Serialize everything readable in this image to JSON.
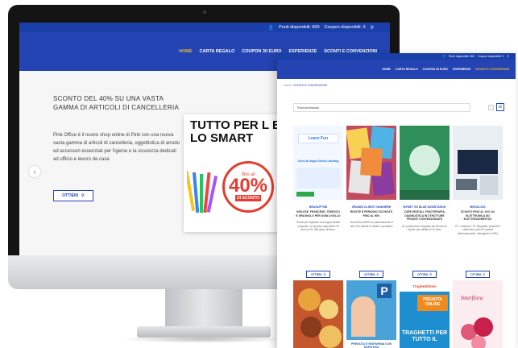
{
  "topbar": {
    "points": "Punti disponibili: 600",
    "coupons": "Coupon disponibili: 3",
    "search_icon": "search-icon",
    "user_icon": "user-icon"
  },
  "nav": {
    "items": [
      "HOME",
      "CARTA REGALO",
      "COUPON 30 EURO",
      "ESPERIENZE",
      "SCONTI E CONVENZIONI"
    ]
  },
  "hero": {
    "title": "SCONTO DEL 40% SU UNA VASTA GAMMA DI ARTICOLI DI CANCELLERIA",
    "body": "Pink Office è il nuovo shop online di Pink con una nuova vasta gamma di articoli di cancelleria, oggettistica di arredo ed accessori essenziali per l'igiene e la sicurezza dedicati ad ufficio e lavoro da casa",
    "button": "OTTIENI",
    "card_title": "TUTTO PER L E LO SMART",
    "promo_fino": "fino al",
    "promo_num": "40%",
    "promo_sconto": "DI SCONTO"
  },
  "shot": {
    "breadcrumb_home": "Home",
    "breadcrumb_sep": "/",
    "breadcrumb_current": "SCONTI E CONVENZIONI",
    "search_label": "Ricerca testuale",
    "cards": [
      {
        "title": "BEASOFTSB",
        "subtitle": "INGLESE, FRANCESE, TEDESCO E SPAGNOLO PER OGNI LIVELLO",
        "desc": "Scuoti per imparare una lingua tramite computer: un accesso disponibile 20 anni su 24, 365 giorni all'anno.",
        "button": "OTTIENI"
      },
      {
        "title": "GRANDI CLIENTI VANNIERE",
        "subtitle": "RIVISTE E PERIODICI SCONTATI FINO AL 90%",
        "desc": "Sconti fino all'80% su abbonamenti di oltre 100 testate di riviste e quotidiani",
        "button": "OTTIENI"
      },
      {
        "title": "MYNET SS BLUE ASSISTANCE",
        "subtitle": "CURE DENTALI, FISIOTERAPIA, DIAGNOSTICA IN STRUTTURE PRIVATE CONVENZIONATE",
        "desc": "Un promozione l'acquisto del servizio di Mynet con validità di 12 mesi",
        "button": "OTTIENI"
      },
      {
        "title": "MONCLICK",
        "subtitle": "SCONTO FINO AL 10% SU ELETTRONICA ED ELETTRODOMESTICI",
        "desc": "PC, notebook, TV, fotografia, prodotti di elettronica, piccoli e grandi elettrodomestici, videogiochi e MP4",
        "button": "OTTIENI"
      }
    ],
    "row2_labels": {
      "parking": "PRENOTA E RISPARMIA CON MyParking",
      "prenota": "PRENOTA ONLINE",
      "traghetti": "TRAGHETTI PER TUTTO IL",
      "brand_traghetti": "Traghettilines",
      "brand_interflora": "Interflora",
      "learn": "Learn Fun",
      "corsi": "Corsi di lingue Dexit Learning"
    }
  },
  "colors": {
    "brand_blue": "#2444b3",
    "topbar_blue": "#1a3fa8",
    "active_yellow": "#f0b728",
    "promo_red": "#e63b2e"
  }
}
